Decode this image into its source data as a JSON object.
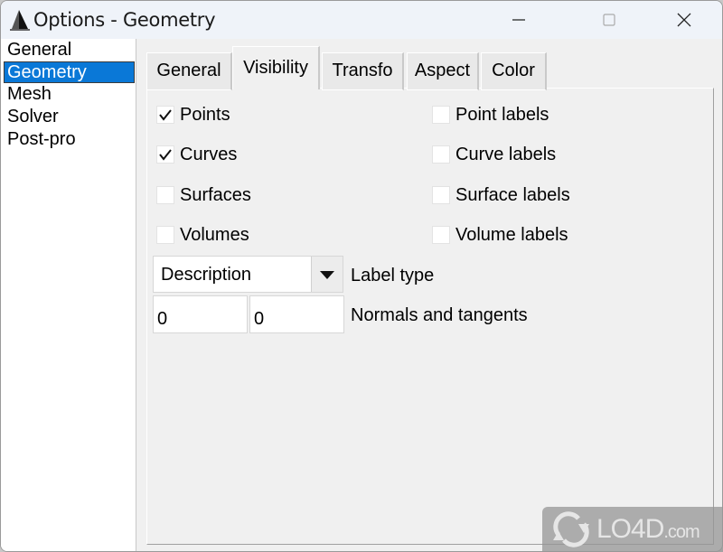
{
  "window": {
    "title": "Options - Geometry",
    "controls": {
      "minimize": "minimize",
      "maximize": "maximize",
      "close": "close"
    }
  },
  "sidebar": {
    "items": [
      {
        "label": "General",
        "selected": false
      },
      {
        "label": "Geometry",
        "selected": true
      },
      {
        "label": "Mesh",
        "selected": false
      },
      {
        "label": "Solver",
        "selected": false
      },
      {
        "label": "Post-pro",
        "selected": false
      }
    ]
  },
  "tabs": [
    {
      "label": "General",
      "active": false
    },
    {
      "label": "Visibility",
      "active": true
    },
    {
      "label": "Transfo",
      "active": false
    },
    {
      "label": "Aspect",
      "active": false
    },
    {
      "label": "Color",
      "active": false
    }
  ],
  "visibility": {
    "left_checkboxes": [
      {
        "label": "Points",
        "checked": true
      },
      {
        "label": "Curves",
        "checked": true
      },
      {
        "label": "Surfaces",
        "checked": false
      },
      {
        "label": "Volumes",
        "checked": false
      }
    ],
    "right_checkboxes": [
      {
        "label": "Point labels",
        "checked": false
      },
      {
        "label": "Curve labels",
        "checked": false
      },
      {
        "label": "Surface labels",
        "checked": false
      },
      {
        "label": "Volume labels",
        "checked": false
      }
    ],
    "label_type": {
      "value": "Description",
      "label": "Label type"
    },
    "normals": {
      "value1": "0",
      "value2": "0",
      "label": "Normals and tangents"
    }
  },
  "watermark": {
    "text": "LO4D",
    "suffix": ".com"
  },
  "colors": {
    "selection": "#0a78d7",
    "titlebar": "#eff3f9",
    "panel": "#f0f0f0"
  }
}
